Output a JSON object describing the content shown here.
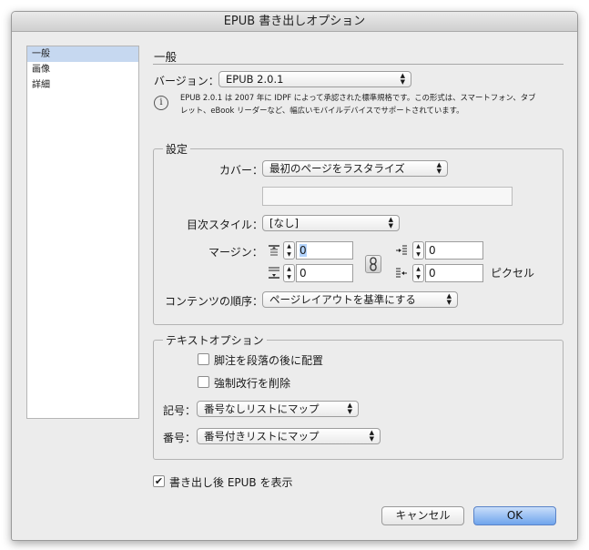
{
  "window": {
    "title": "EPUB 書き出しオプション"
  },
  "sidebar": {
    "items": [
      {
        "label": "一般",
        "selected": true
      },
      {
        "label": "画像",
        "selected": false
      },
      {
        "label": "詳細",
        "selected": false
      }
    ]
  },
  "general": {
    "section_title": "一般",
    "version_label": "バージョン：",
    "version_value": "EPUB 2.0.1",
    "info_line1": "EPUB 2.0.1 は 2007 年に IDPF によって承認された標準規格です。この形式は、スマートフォン、タブ",
    "info_line2": "レット、eBook リーダーなど、幅広いモバイルデバイスでサポートされています。"
  },
  "settings": {
    "group_label": "設定",
    "cover_label": "カバー：",
    "cover_value": "最初のページをラスタライズ",
    "cover_path_value": "",
    "toc_label": "目次スタイル：",
    "toc_value": "[なし]",
    "margin_label": "マージン：",
    "margin_top": "0",
    "margin_bottom": "0",
    "margin_left": "0",
    "margin_right": "0",
    "margin_unit": "ピクセル",
    "content_order_label": "コンテンツの順序：",
    "content_order_value": "ページレイアウトを基準にする"
  },
  "text_options": {
    "group_label": "テキストオプション",
    "footnote_label": "脚注を段落の後に配置",
    "footnote_checked": false,
    "linebreak_label": "強制改行を削除",
    "linebreak_checked": false,
    "bullets_label": "記号：",
    "bullets_value": "番号なしリストにマップ",
    "numbers_label": "番号：",
    "numbers_value": "番号付きリストにマップ"
  },
  "footer": {
    "view_after_label": "書き出し後 EPUB を表示",
    "view_after_checked": true,
    "checkmark": "✔",
    "cancel_label": "キャンセル",
    "ok_label": "OK"
  },
  "glyphs": {
    "popup_up": "▲",
    "popup_down": "▼",
    "info": "i"
  },
  "icons": [
    "info-icon",
    "margin-top-icon",
    "margin-bottom-icon",
    "margin-left-icon",
    "margin-right-icon",
    "chain-link-icon",
    "popup-arrows-icon",
    "checkmark-icon"
  ],
  "colors": {
    "window_bg": "#ececec",
    "selection": "#c6d8f0",
    "default_button": "#6fa4ec",
    "number_highlight": "#b3d4fd"
  }
}
